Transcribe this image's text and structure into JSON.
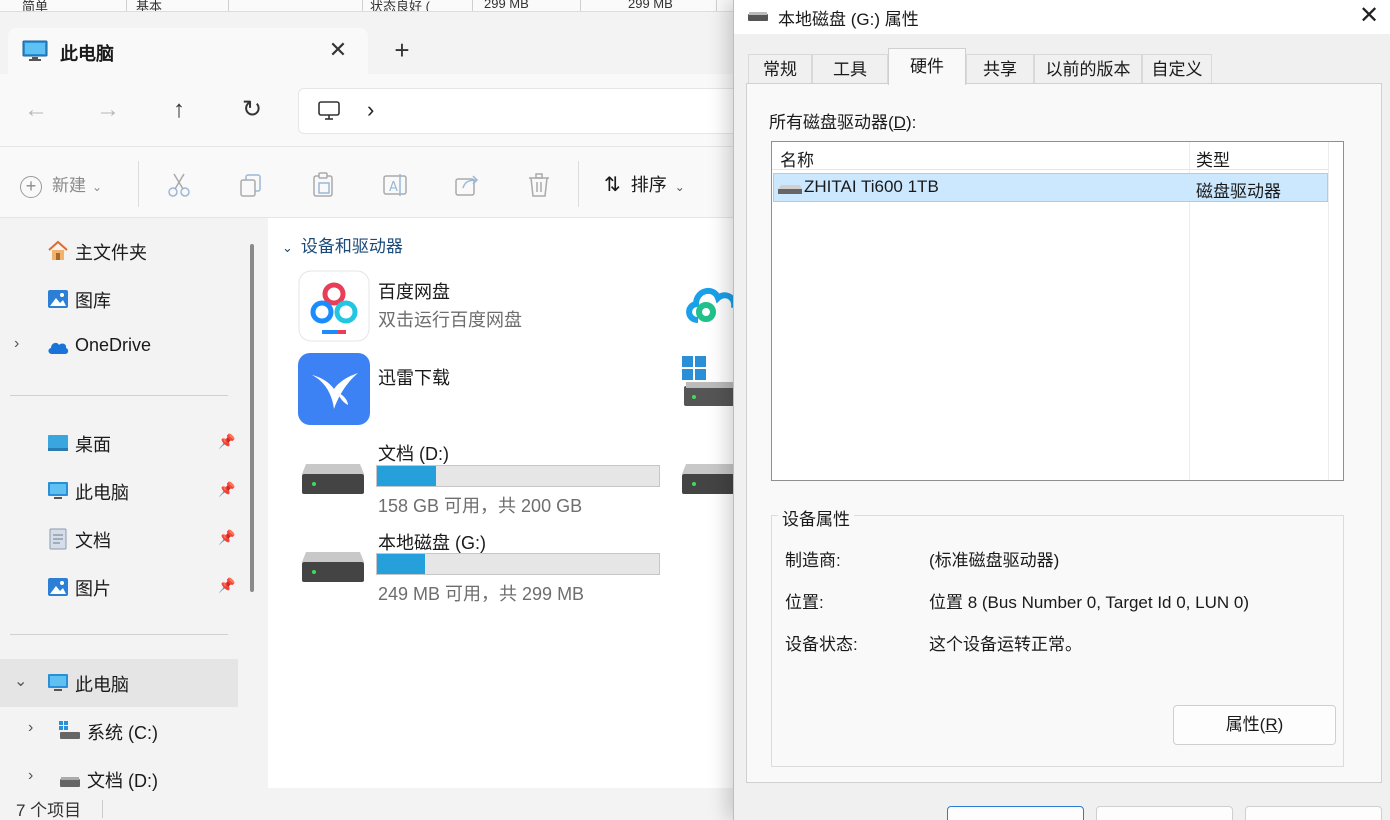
{
  "background_window": {
    "cells": [
      "简单",
      "基本",
      "状态良好 (",
      "299 MB",
      "299 MB"
    ]
  },
  "explorer": {
    "tab_title": "此电脑",
    "new_button": "新建",
    "sort_button": "排序",
    "sidebar": {
      "quick": [
        {
          "label": "主文件夹",
          "icon": "home-icon"
        },
        {
          "label": "图库",
          "icon": "gallery-icon"
        },
        {
          "label": "OneDrive",
          "icon": "cloud-icon"
        }
      ],
      "pinned": [
        {
          "label": "桌面",
          "icon": "desktop-icon"
        },
        {
          "label": "此电脑",
          "icon": "monitor-icon"
        },
        {
          "label": "文档",
          "icon": "document-icon"
        },
        {
          "label": "图片",
          "icon": "picture-icon"
        }
      ],
      "tree": [
        {
          "label": "此电脑"
        },
        {
          "label": "系统 (C:)"
        },
        {
          "label": "文档 (D:)"
        }
      ]
    },
    "group_title": "设备和驱动器",
    "items": {
      "baidu": {
        "name": "百度网盘",
        "sub": "双击运行百度网盘"
      },
      "xunlei": {
        "name": "迅雷下载"
      },
      "drive_d": {
        "name": "文档 (D:)",
        "sub": "158 GB 可用，共 200 GB",
        "used_fraction": 0.21
      },
      "drive_g": {
        "name": "本地磁盘 (G:)",
        "sub": "249 MB 可用，共 299 MB",
        "used_fraction": 0.17
      }
    },
    "status": "7 个项目"
  },
  "dialog": {
    "title": "本地磁盘 (G:) 属性",
    "tabs": [
      "常规",
      "工具",
      "硬件",
      "共享",
      "以前的版本",
      "自定义"
    ],
    "active_tab": "硬件",
    "drives_label": "所有磁盘驱动器(D):",
    "drives_label_main": "所有磁盘驱动器(",
    "drives_label_key": "D",
    "drives_label_end": "):",
    "columns": [
      "名称",
      "类型"
    ],
    "row": {
      "name": "ZHITAI Ti600 1TB",
      "type": "磁盘驱动器"
    },
    "props_legend": "设备属性",
    "props": [
      {
        "key": "制造商:",
        "value": "(标准磁盘驱动器)"
      },
      {
        "key": "位置:",
        "value": "位置 8 (Bus Number 0, Target Id 0, LUN 0)"
      },
      {
        "key": "设备状态:",
        "value": "这个设备运转正常。"
      }
    ],
    "props_button_main": "属性(",
    "props_button_key": "R",
    "props_button_end": ")"
  },
  "colors": {
    "accent": "#26a0da",
    "selection": "#cce8ff"
  }
}
